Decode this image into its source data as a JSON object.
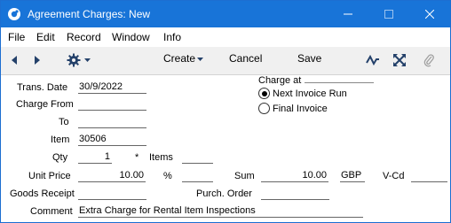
{
  "window": {
    "title": "Agreement Charges: New"
  },
  "menu": [
    "File",
    "Edit",
    "Record",
    "Window",
    "Info"
  ],
  "toolbar": {
    "create": "Create",
    "cancel": "Cancel",
    "save": "Save"
  },
  "form": {
    "trans_date_label": "Trans. Date",
    "trans_date_value": "30/9/2022",
    "charge_from_label": "Charge From",
    "charge_from_value": "",
    "to_label": "To",
    "to_value": "",
    "item_label": "Item",
    "item_value": "30506",
    "qty_label": "Qty",
    "qty_value": "1",
    "asterisk": "*",
    "items_label": "Items",
    "items_value": "",
    "unit_price_label": "Unit Price",
    "unit_price_value": "10.00",
    "percent_label": "%",
    "percent_value": "",
    "sum_label": "Sum",
    "sum_value": "10.00",
    "currency_value": "GBP",
    "vcd_label": "V-Cd",
    "vcd_value": "",
    "goods_receipt_label": "Goods Receipt",
    "goods_receipt_value": "",
    "purch_order_label": "Purch. Order",
    "purch_order_value": "",
    "comment_label": "Comment",
    "comment_value": "Extra Charge for Rental Item Inspections",
    "charge_at_label": "Charge at",
    "charge_at_options": [
      {
        "label": "Next Invoice Run",
        "selected": true
      },
      {
        "label": "Final Invoice",
        "selected": false
      }
    ]
  }
}
